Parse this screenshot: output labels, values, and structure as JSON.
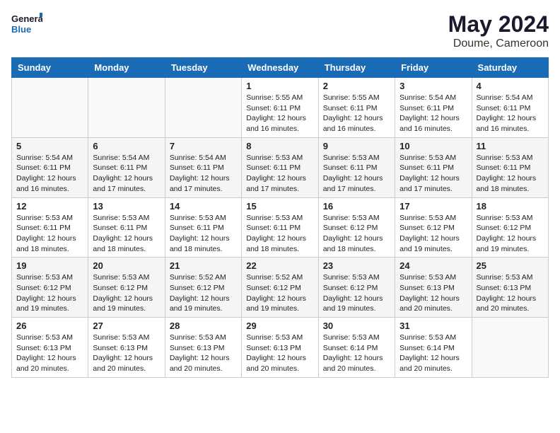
{
  "header": {
    "logo_line1": "General",
    "logo_line2": "Blue",
    "month_year": "May 2024",
    "location": "Doume, Cameroon"
  },
  "weekdays": [
    "Sunday",
    "Monday",
    "Tuesday",
    "Wednesday",
    "Thursday",
    "Friday",
    "Saturday"
  ],
  "weeks": [
    [
      {
        "day": "",
        "info": ""
      },
      {
        "day": "",
        "info": ""
      },
      {
        "day": "",
        "info": ""
      },
      {
        "day": "1",
        "info": "Sunrise: 5:55 AM\nSunset: 6:11 PM\nDaylight: 12 hours\nand 16 minutes."
      },
      {
        "day": "2",
        "info": "Sunrise: 5:55 AM\nSunset: 6:11 PM\nDaylight: 12 hours\nand 16 minutes."
      },
      {
        "day": "3",
        "info": "Sunrise: 5:54 AM\nSunset: 6:11 PM\nDaylight: 12 hours\nand 16 minutes."
      },
      {
        "day": "4",
        "info": "Sunrise: 5:54 AM\nSunset: 6:11 PM\nDaylight: 12 hours\nand 16 minutes."
      }
    ],
    [
      {
        "day": "5",
        "info": "Sunrise: 5:54 AM\nSunset: 6:11 PM\nDaylight: 12 hours\nand 16 minutes."
      },
      {
        "day": "6",
        "info": "Sunrise: 5:54 AM\nSunset: 6:11 PM\nDaylight: 12 hours\nand 17 minutes."
      },
      {
        "day": "7",
        "info": "Sunrise: 5:54 AM\nSunset: 6:11 PM\nDaylight: 12 hours\nand 17 minutes."
      },
      {
        "day": "8",
        "info": "Sunrise: 5:53 AM\nSunset: 6:11 PM\nDaylight: 12 hours\nand 17 minutes."
      },
      {
        "day": "9",
        "info": "Sunrise: 5:53 AM\nSunset: 6:11 PM\nDaylight: 12 hours\nand 17 minutes."
      },
      {
        "day": "10",
        "info": "Sunrise: 5:53 AM\nSunset: 6:11 PM\nDaylight: 12 hours\nand 17 minutes."
      },
      {
        "day": "11",
        "info": "Sunrise: 5:53 AM\nSunset: 6:11 PM\nDaylight: 12 hours\nand 18 minutes."
      }
    ],
    [
      {
        "day": "12",
        "info": "Sunrise: 5:53 AM\nSunset: 6:11 PM\nDaylight: 12 hours\nand 18 minutes."
      },
      {
        "day": "13",
        "info": "Sunrise: 5:53 AM\nSunset: 6:11 PM\nDaylight: 12 hours\nand 18 minutes."
      },
      {
        "day": "14",
        "info": "Sunrise: 5:53 AM\nSunset: 6:11 PM\nDaylight: 12 hours\nand 18 minutes."
      },
      {
        "day": "15",
        "info": "Sunrise: 5:53 AM\nSunset: 6:11 PM\nDaylight: 12 hours\nand 18 minutes."
      },
      {
        "day": "16",
        "info": "Sunrise: 5:53 AM\nSunset: 6:12 PM\nDaylight: 12 hours\nand 18 minutes."
      },
      {
        "day": "17",
        "info": "Sunrise: 5:53 AM\nSunset: 6:12 PM\nDaylight: 12 hours\nand 19 minutes."
      },
      {
        "day": "18",
        "info": "Sunrise: 5:53 AM\nSunset: 6:12 PM\nDaylight: 12 hours\nand 19 minutes."
      }
    ],
    [
      {
        "day": "19",
        "info": "Sunrise: 5:53 AM\nSunset: 6:12 PM\nDaylight: 12 hours\nand 19 minutes."
      },
      {
        "day": "20",
        "info": "Sunrise: 5:53 AM\nSunset: 6:12 PM\nDaylight: 12 hours\nand 19 minutes."
      },
      {
        "day": "21",
        "info": "Sunrise: 5:52 AM\nSunset: 6:12 PM\nDaylight: 12 hours\nand 19 minutes."
      },
      {
        "day": "22",
        "info": "Sunrise: 5:52 AM\nSunset: 6:12 PM\nDaylight: 12 hours\nand 19 minutes."
      },
      {
        "day": "23",
        "info": "Sunrise: 5:53 AM\nSunset: 6:12 PM\nDaylight: 12 hours\nand 19 minutes."
      },
      {
        "day": "24",
        "info": "Sunrise: 5:53 AM\nSunset: 6:13 PM\nDaylight: 12 hours\nand 20 minutes."
      },
      {
        "day": "25",
        "info": "Sunrise: 5:53 AM\nSunset: 6:13 PM\nDaylight: 12 hours\nand 20 minutes."
      }
    ],
    [
      {
        "day": "26",
        "info": "Sunrise: 5:53 AM\nSunset: 6:13 PM\nDaylight: 12 hours\nand 20 minutes."
      },
      {
        "day": "27",
        "info": "Sunrise: 5:53 AM\nSunset: 6:13 PM\nDaylight: 12 hours\nand 20 minutes."
      },
      {
        "day": "28",
        "info": "Sunrise: 5:53 AM\nSunset: 6:13 PM\nDaylight: 12 hours\nand 20 minutes."
      },
      {
        "day": "29",
        "info": "Sunrise: 5:53 AM\nSunset: 6:13 PM\nDaylight: 12 hours\nand 20 minutes."
      },
      {
        "day": "30",
        "info": "Sunrise: 5:53 AM\nSunset: 6:14 PM\nDaylight: 12 hours\nand 20 minutes."
      },
      {
        "day": "31",
        "info": "Sunrise: 5:53 AM\nSunset: 6:14 PM\nDaylight: 12 hours\nand 20 minutes."
      },
      {
        "day": "",
        "info": ""
      }
    ]
  ]
}
